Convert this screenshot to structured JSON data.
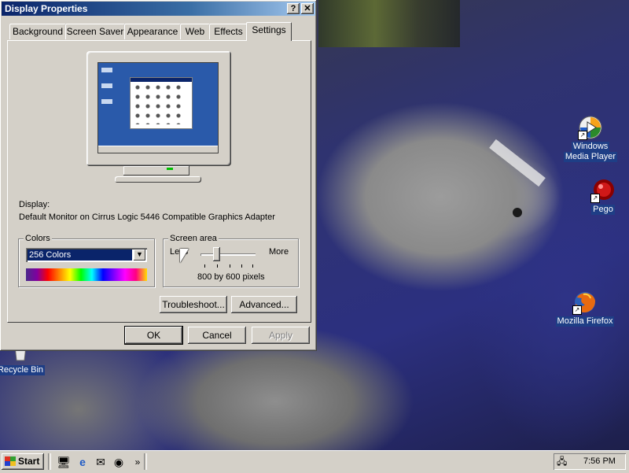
{
  "window": {
    "title": "Display Properties",
    "help_label": "?",
    "close_label": "✕"
  },
  "tabs": [
    {
      "label": "Background"
    },
    {
      "label": "Screen Saver"
    },
    {
      "label": "Appearance"
    },
    {
      "label": "Web"
    },
    {
      "label": "Effects"
    },
    {
      "label": "Settings",
      "selected": true
    }
  ],
  "display": {
    "heading": "Display:",
    "device": "Default Monitor on Cirrus Logic 5446 Compatible Graphics Adapter"
  },
  "colors": {
    "group_label": "Colors",
    "selected": "256 Colors",
    "dropdown_glyph": "▼"
  },
  "screen_area": {
    "group_label": "Screen area",
    "less_label": "Less",
    "more_label": "More",
    "resolution_text": "800 by 600 pixels"
  },
  "buttons": {
    "troubleshoot": "Troubleshoot...",
    "advanced": "Advanced...",
    "ok": "OK",
    "cancel": "Cancel",
    "apply": "Apply"
  },
  "desktop_icons": [
    {
      "label_line1": "Windows",
      "label_line2": "Media Player",
      "icon": "media-player-icon"
    },
    {
      "label_line1": "Pego",
      "label_line2": "",
      "icon": "red-ball-icon"
    },
    {
      "label_line1": "Mozilla Firefox",
      "label_line2": "",
      "icon": "firefox-icon"
    },
    {
      "label_line1": "Recycle Bin",
      "label_line2": "",
      "icon": "recycle-bin-icon"
    }
  ],
  "taskbar": {
    "start_label": "Start",
    "overflow_glyph": "»",
    "clock": "7:56 PM",
    "quick_launch": [
      "show-desktop-icon",
      "internet-explorer-icon",
      "outlook-express-icon",
      "channels-icon"
    ]
  },
  "colors_theme": {
    "face": "#d4d0c8",
    "titlebar_start": "#0a246a",
    "titlebar_end": "#a6caf0",
    "selection": "#0a246a"
  }
}
